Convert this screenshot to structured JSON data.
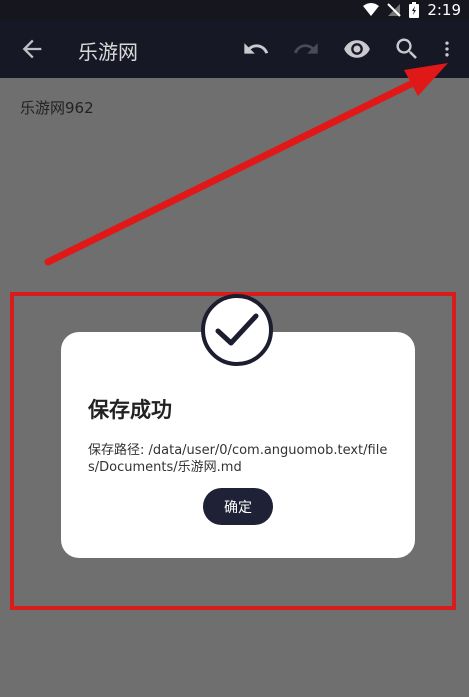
{
  "status_bar": {
    "time": "2:19"
  },
  "app_bar": {
    "title": "乐游网"
  },
  "editor": {
    "text": "乐游网962"
  },
  "dialog": {
    "title": "保存成功",
    "message": "保存路径: /data/user/0/com.anguomob.text/files/Documents/乐游网.md",
    "confirm_label": "确定"
  },
  "colors": {
    "app_bar": "#171826",
    "background": "#6f6f6f",
    "highlight": "#d81b1b",
    "button": "#1f2136"
  }
}
